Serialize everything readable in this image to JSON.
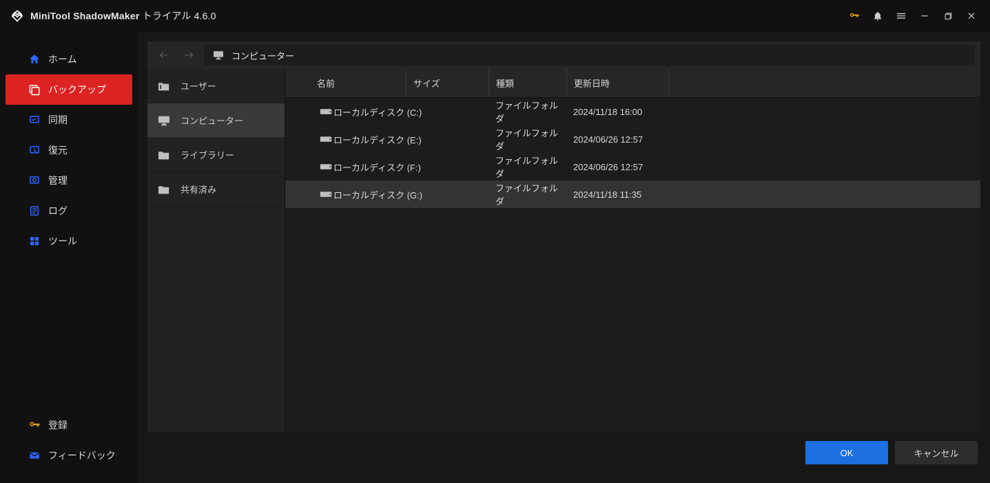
{
  "title": {
    "app": "MiniTool ShadowMaker",
    "suffix": " トライアル 4.6.0"
  },
  "nav": {
    "home": "ホーム",
    "backup": "バックアップ",
    "sync": "同期",
    "restore": "復元",
    "manage": "管理",
    "log": "ログ",
    "tools": "ツール",
    "register": "登録",
    "feedback": "フィードバック"
  },
  "breadcrumb": {
    "location": "コンピューター"
  },
  "tree": {
    "user": "ユーザー",
    "computer": "コンピューター",
    "library": "ライブラリー",
    "shared": "共有済み"
  },
  "cols": {
    "name": "名前",
    "size": "サイズ",
    "type": "種類",
    "date": "更新日時"
  },
  "rows": [
    {
      "name": "ローカルディスク (C:)",
      "type": "ファイルフォルダ",
      "date": "2024/11/18 16:00"
    },
    {
      "name": "ローカルディスク (E:)",
      "type": "ファイルフォルダ",
      "date": "2024/06/26 12:57"
    },
    {
      "name": "ローカルディスク (F:)",
      "type": "ファイルフォルダ",
      "date": "2024/06/26 12:57"
    },
    {
      "name": "ローカルディスク (G:)",
      "type": "ファイルフォルダ",
      "date": "2024/11/18 11:35"
    }
  ],
  "buttons": {
    "ok": "OK",
    "cancel": "キャンセル"
  }
}
